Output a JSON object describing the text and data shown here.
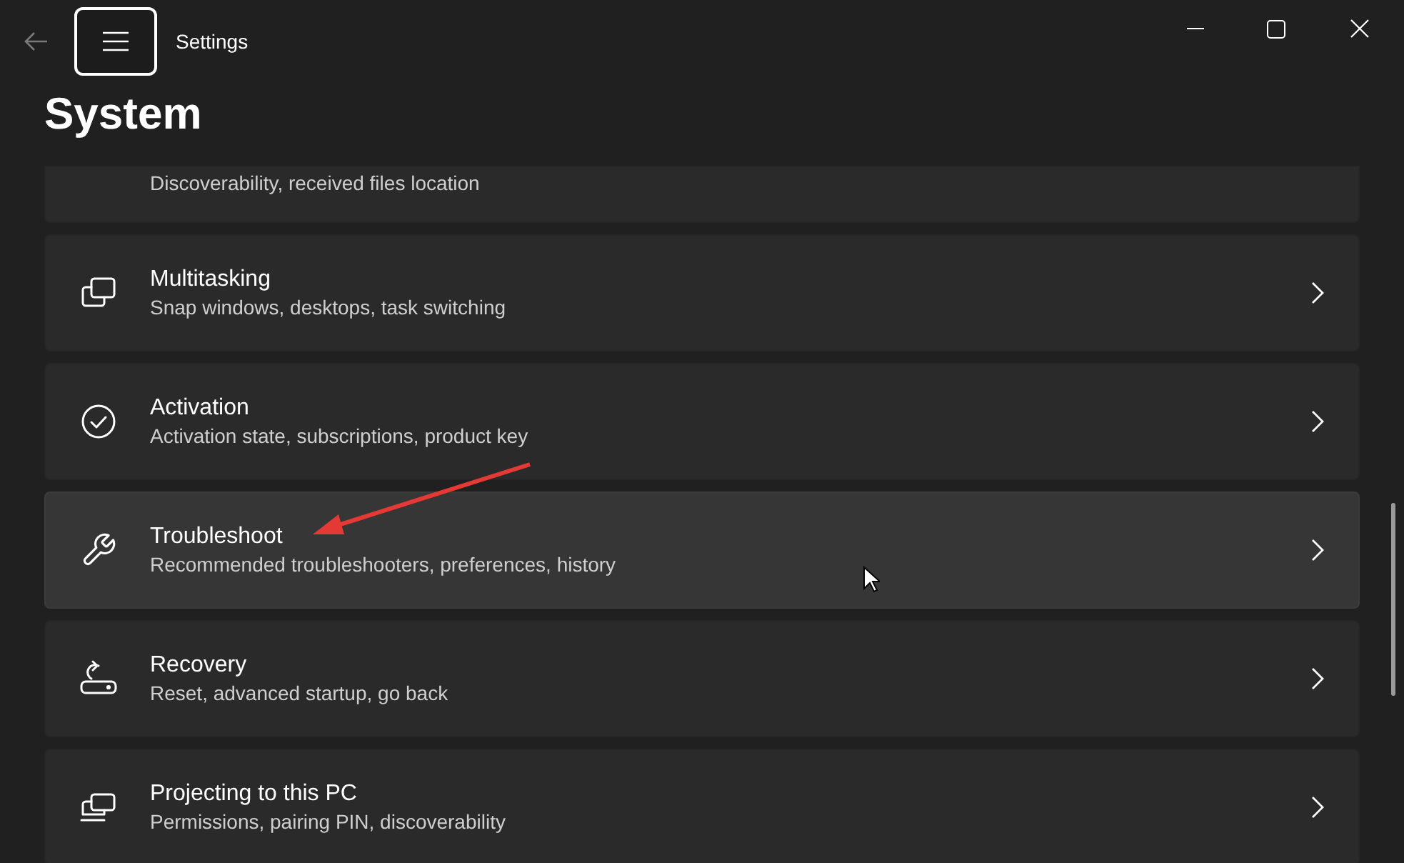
{
  "window": {
    "title": "Settings"
  },
  "page_title": "System",
  "items": [
    {
      "kind": "partial",
      "subtitle": "Discoverability, received files location",
      "hovered": false
    },
    {
      "kind": "full",
      "title": "Multitasking",
      "subtitle": "Snap windows, desktops, task switching",
      "hovered": false
    },
    {
      "kind": "full",
      "title": "Activation",
      "subtitle": "Activation state, subscriptions, product key",
      "hovered": false
    },
    {
      "kind": "full",
      "title": "Troubleshoot",
      "subtitle": "Recommended troubleshooters, preferences, history",
      "hovered": true
    },
    {
      "kind": "full",
      "title": "Recovery",
      "subtitle": "Reset, advanced startup, go back",
      "hovered": false
    },
    {
      "kind": "full",
      "title": "Projecting to this PC",
      "subtitle": "Permissions, pairing PIN, discoverability",
      "hovered": false
    }
  ]
}
